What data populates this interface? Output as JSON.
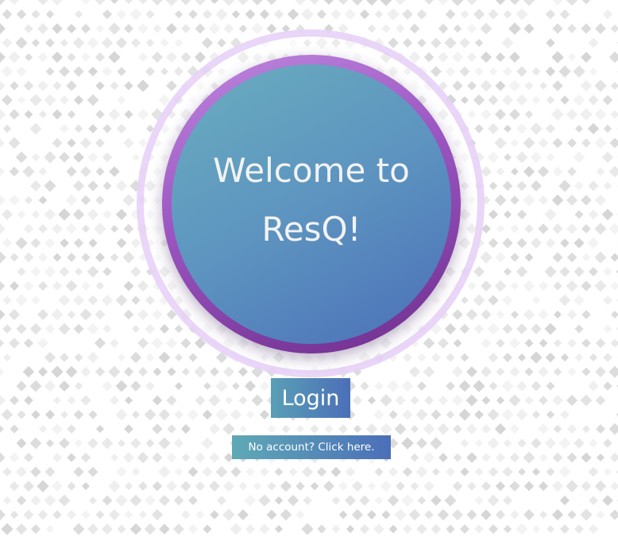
{
  "hero": {
    "line1": "Welcome to",
    "line2": "ResQ!"
  },
  "actions": {
    "login_label": "Login",
    "signup_label": "No account? Click here."
  },
  "colors": {
    "circle_gradient_start": "#6aaebe",
    "circle_gradient_end": "#4b6fb8",
    "ring_purple": "#9a55c0",
    "halo": "#e1c8f5"
  }
}
